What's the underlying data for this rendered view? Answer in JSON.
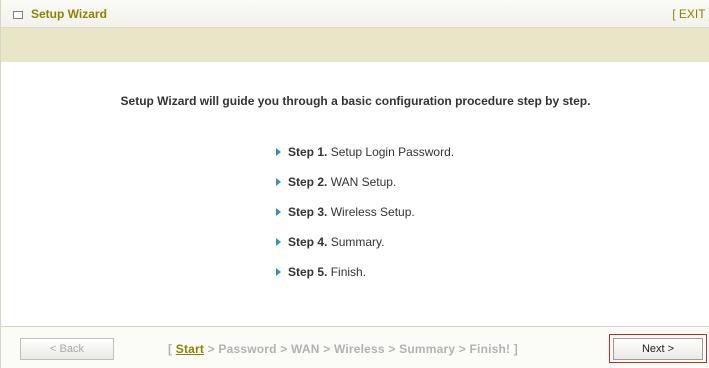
{
  "header": {
    "title": "Setup Wizard",
    "exit_label": "[ EXIT ]"
  },
  "main": {
    "intro": "Setup Wizard will guide you through a basic configuration procedure step by step.",
    "steps": [
      {
        "num": "Step 1.",
        "text": "Setup Login Password."
      },
      {
        "num": "Step 2.",
        "text": "WAN Setup."
      },
      {
        "num": "Step 3.",
        "text": "Wireless Setup."
      },
      {
        "num": "Step 4.",
        "text": "Summary."
      },
      {
        "num": "Step 5.",
        "text": "Finish."
      }
    ]
  },
  "footer": {
    "back_label": "< Back",
    "next_label": "Next >",
    "breadcrumb": {
      "open": "[",
      "current": "Start",
      "sep": ">",
      "rest": [
        "Password",
        "WAN",
        "Wireless",
        "Summary",
        "Finish!"
      ],
      "close": "]"
    }
  },
  "colors": {
    "accent": "#8a8400",
    "band": "#e9e6c8",
    "step_arrow": "#3a8fb7",
    "highlight_outline": "#cc2a2a"
  }
}
